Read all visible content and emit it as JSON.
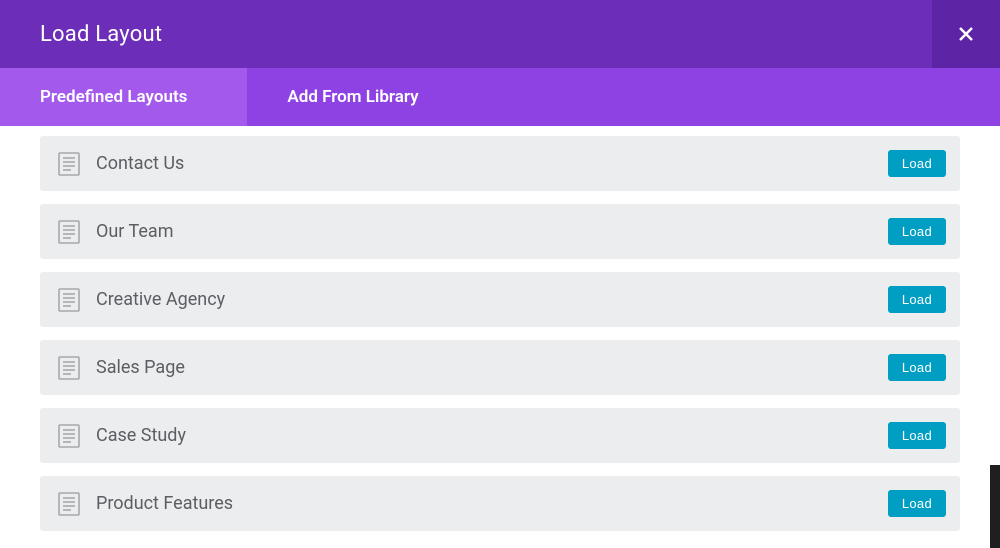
{
  "header": {
    "title": "Load Layout"
  },
  "tabs": [
    {
      "label": "Predefined Layouts",
      "active": true
    },
    {
      "label": "Add From Library",
      "active": false
    }
  ],
  "load_button_label": "Load",
  "layouts": [
    {
      "name": "Contact Us"
    },
    {
      "name": "Our Team"
    },
    {
      "name": "Creative Agency"
    },
    {
      "name": "Sales Page"
    },
    {
      "name": "Case Study"
    },
    {
      "name": "Product Features"
    }
  ],
  "colors": {
    "header_bg": "#6c2eb9",
    "header_bg_dark": "#5e24a6",
    "tabs_bg": "#8e42e3",
    "tab_active_bg": "#a259ec",
    "row_bg": "#ebedee",
    "load_btn_bg": "#009ec2",
    "text_muted": "#5b5e63"
  }
}
